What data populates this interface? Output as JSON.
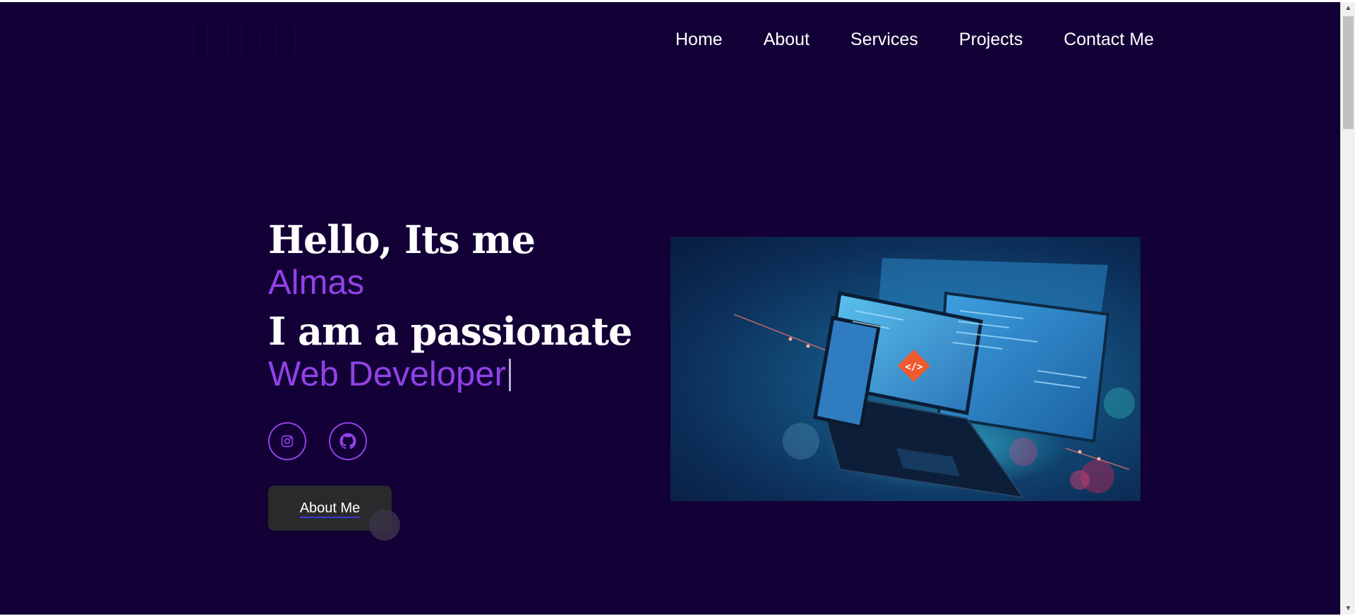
{
  "nav": {
    "links": [
      "Home",
      "About",
      "Services",
      "Projects",
      "Contact Me"
    ]
  },
  "hero": {
    "greeting": "Hello, Its me",
    "name": "Almas",
    "line2": "I am a passionate",
    "role": "Web Developer",
    "button_label": "About Me"
  },
  "socials": [
    {
      "icon": "instagram-icon"
    },
    {
      "icon": "github-icon"
    }
  ],
  "colors": {
    "background": "#120036",
    "accent": "#9142e6",
    "button": "#2a2a2c",
    "text": "#ffffff"
  },
  "hero_image": {
    "icon": "code-icon",
    "content": "laptop-and-devices-illustration"
  }
}
